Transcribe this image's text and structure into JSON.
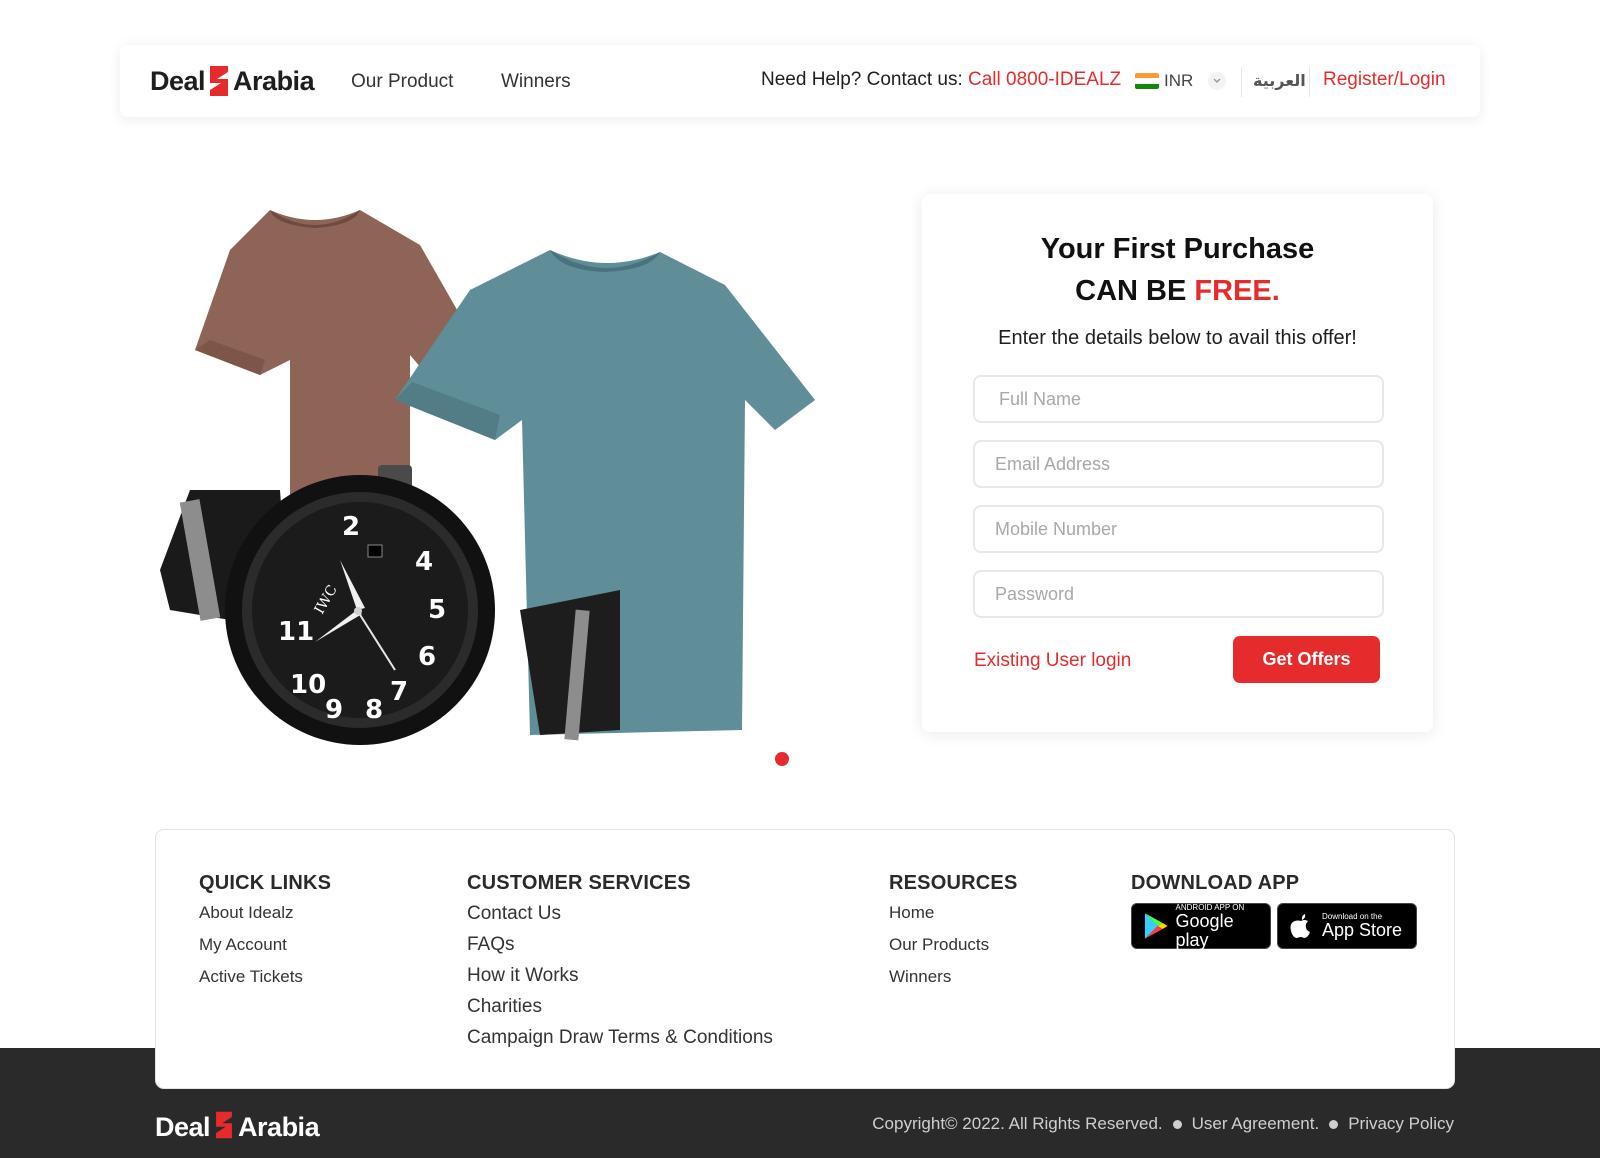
{
  "brand": {
    "name_left": "Deal",
    "name_right": "Arabia",
    "accent": "#e52b2b"
  },
  "header": {
    "nav": [
      "Our Product",
      "Winners"
    ],
    "help_text": "Need Help? Contact us:",
    "help_phone": "Call 0800-IDEALZ",
    "currency": "INR",
    "language": "العربية",
    "register": "Register/Login"
  },
  "hero": {
    "images": [
      "brown-tshirt",
      "teal-tshirt",
      "black-watch"
    ],
    "watch_brand": "IWC",
    "carousel_dots": 1
  },
  "offer": {
    "title_line1": "Your First Purchase",
    "title_line2_a": "CAN BE",
    "title_line2_b": "FREE.",
    "subtitle": "Enter the details below to avail this offer!",
    "fields": {
      "full_name": "Full Name",
      "email": "Email Address",
      "mobile": "Mobile Number",
      "password": "Password"
    },
    "existing_login": "Existing User login",
    "cta": "Get Offers"
  },
  "footer": {
    "quick_links": {
      "title": "QUICK LINKS",
      "items": [
        "About Idealz",
        "My Account",
        "Active Tickets"
      ]
    },
    "customer_services": {
      "title": "CUSTOMER SERVICES",
      "items": [
        "Contact Us",
        "FAQs",
        "How it Works",
        "Charities",
        "Campaign Draw Terms & Conditions"
      ]
    },
    "resources": {
      "title": "RESOURCES",
      "items": [
        "Home",
        "Our Products",
        "Winners"
      ]
    },
    "download": {
      "title": "DOWNLOAD APP",
      "google": {
        "small": "ANDROID APP ON",
        "big": "Google play"
      },
      "apple": {
        "small": "Download on the",
        "big": "App Store"
      }
    },
    "copyright": "Copyright© 2022. All Rights Reserved.",
    "agreement": "User Agreement.",
    "privacy": "Privacy Policy"
  }
}
